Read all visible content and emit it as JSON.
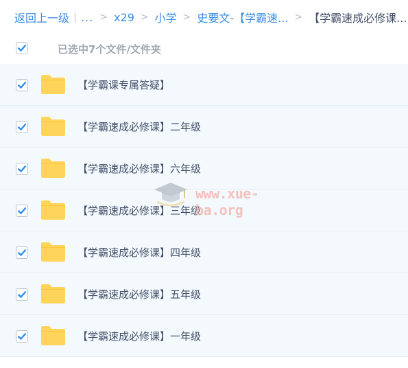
{
  "breadcrumb": {
    "back": "返回上一级",
    "divider": "|",
    "ellipsis": "...",
    "sep": ">",
    "items": [
      "x29",
      "小学",
      "史要文-【学霸速..."
    ],
    "current": "【学霸速成必修课..."
  },
  "selection": {
    "status": "已选中7个文件/文件夹",
    "all_checked": true
  },
  "files": [
    {
      "name": "【学霸课专属答疑】",
      "checked": true
    },
    {
      "name": "【学霸速成必修课】二年级",
      "checked": true
    },
    {
      "name": "【学霸速成必修课】六年级",
      "checked": true
    },
    {
      "name": "【学霸速成必修课】三年级",
      "checked": true
    },
    {
      "name": "【学霸速成必修课】四年级",
      "checked": true
    },
    {
      "name": "【学霸速成必修课】五年级",
      "checked": true
    },
    {
      "name": "【学霸速成必修课】一年级",
      "checked": true
    }
  ],
  "watermark": {
    "text": "www.xue-ba.org",
    "icon": "graduation-cap-icon"
  },
  "colors": {
    "link": "#3a8ee6",
    "check": "#2a8ef0",
    "folder": "#ffd45a",
    "row_bg": "#f3f9fd",
    "text": "#424e67"
  }
}
